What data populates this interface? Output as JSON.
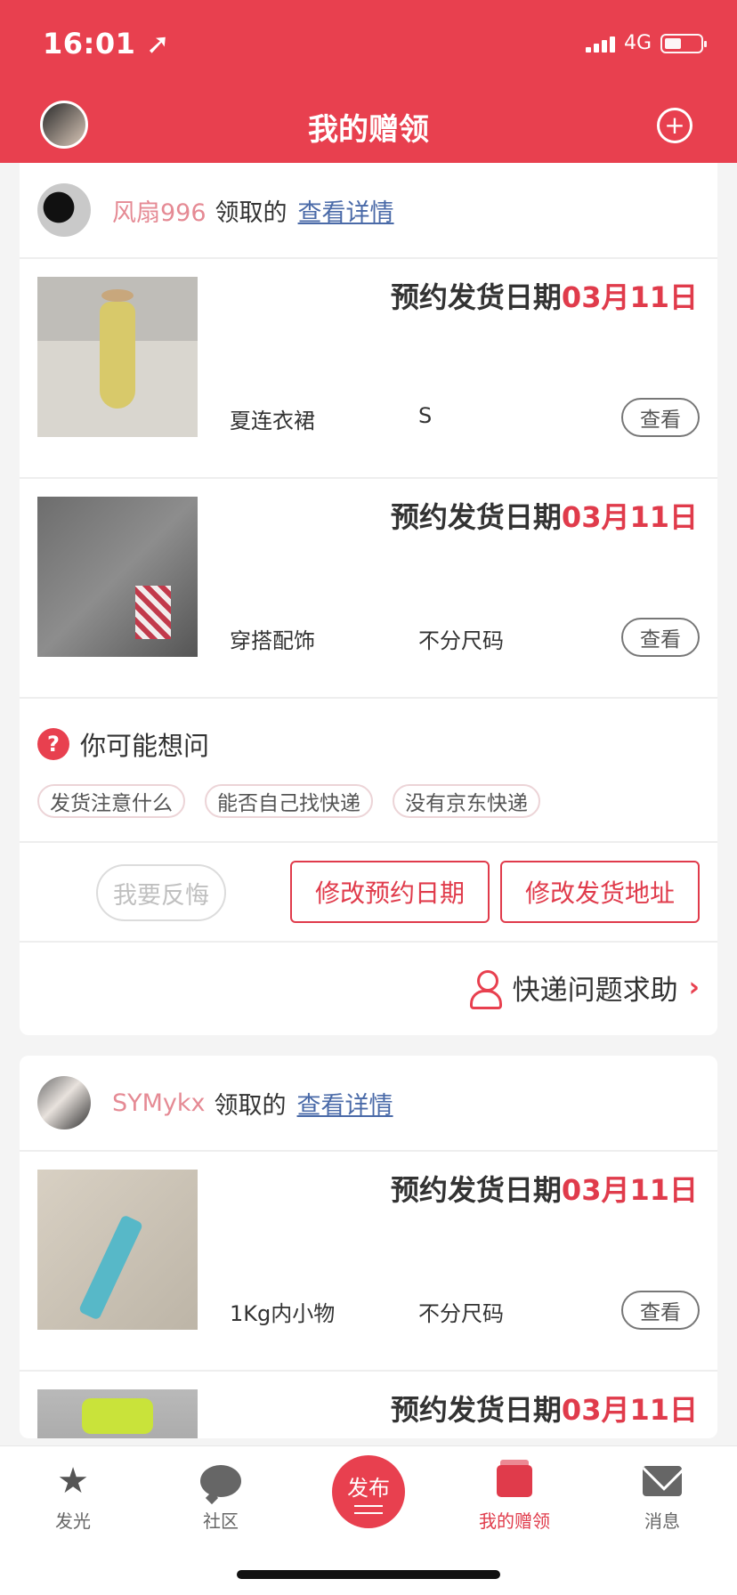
{
  "status": {
    "time": "16:01",
    "network": "4G"
  },
  "header": {
    "title": "我的赠领",
    "add_icon": "plus-circle-icon"
  },
  "orders": [
    {
      "user": "风扇996",
      "user_suffix": "领取的",
      "detail_link": "查看详情",
      "items": [
        {
          "ship_label": "预约发货日期",
          "ship_date": "03月11日",
          "name": "夏连衣裙",
          "size": "S",
          "view": "查看"
        },
        {
          "ship_label": "预约发货日期",
          "ship_date": "03月11日",
          "name": "穿搭配饰",
          "size": "不分尺码",
          "view": "查看"
        }
      ],
      "faq": {
        "title": "你可能想问",
        "icon": "?",
        "chips": [
          "发货注意什么",
          "能否自己找快递",
          "没有京东快递"
        ]
      },
      "actions": {
        "regret": "我要反悔",
        "change_date": "修改预约日期",
        "change_address": "修改发货地址"
      },
      "help": "快递问题求助"
    },
    {
      "user": "SYMykx",
      "user_suffix": "领取的",
      "detail_link": "查看详情",
      "items": [
        {
          "ship_label": "预约发货日期",
          "ship_date": "03月11日",
          "name": "1Kg内小物",
          "size": "不分尺码",
          "view": "查看"
        },
        {
          "ship_label": "预约发货日期",
          "ship_date": "03月11日"
        }
      ]
    }
  ],
  "tabbar": {
    "tabs": [
      {
        "label": "发光",
        "icon": "star-icon"
      },
      {
        "label": "社区",
        "icon": "chat-bubble-icon"
      },
      {
        "label": "发布",
        "icon": "publish-icon"
      },
      {
        "label": "我的赠领",
        "icon": "gift-box-icon",
        "active": true
      },
      {
        "label": "消息",
        "icon": "mail-icon"
      }
    ]
  },
  "colors": {
    "brand": "#e8404f",
    "link": "#4a6aa8",
    "username": "#e58a94"
  }
}
